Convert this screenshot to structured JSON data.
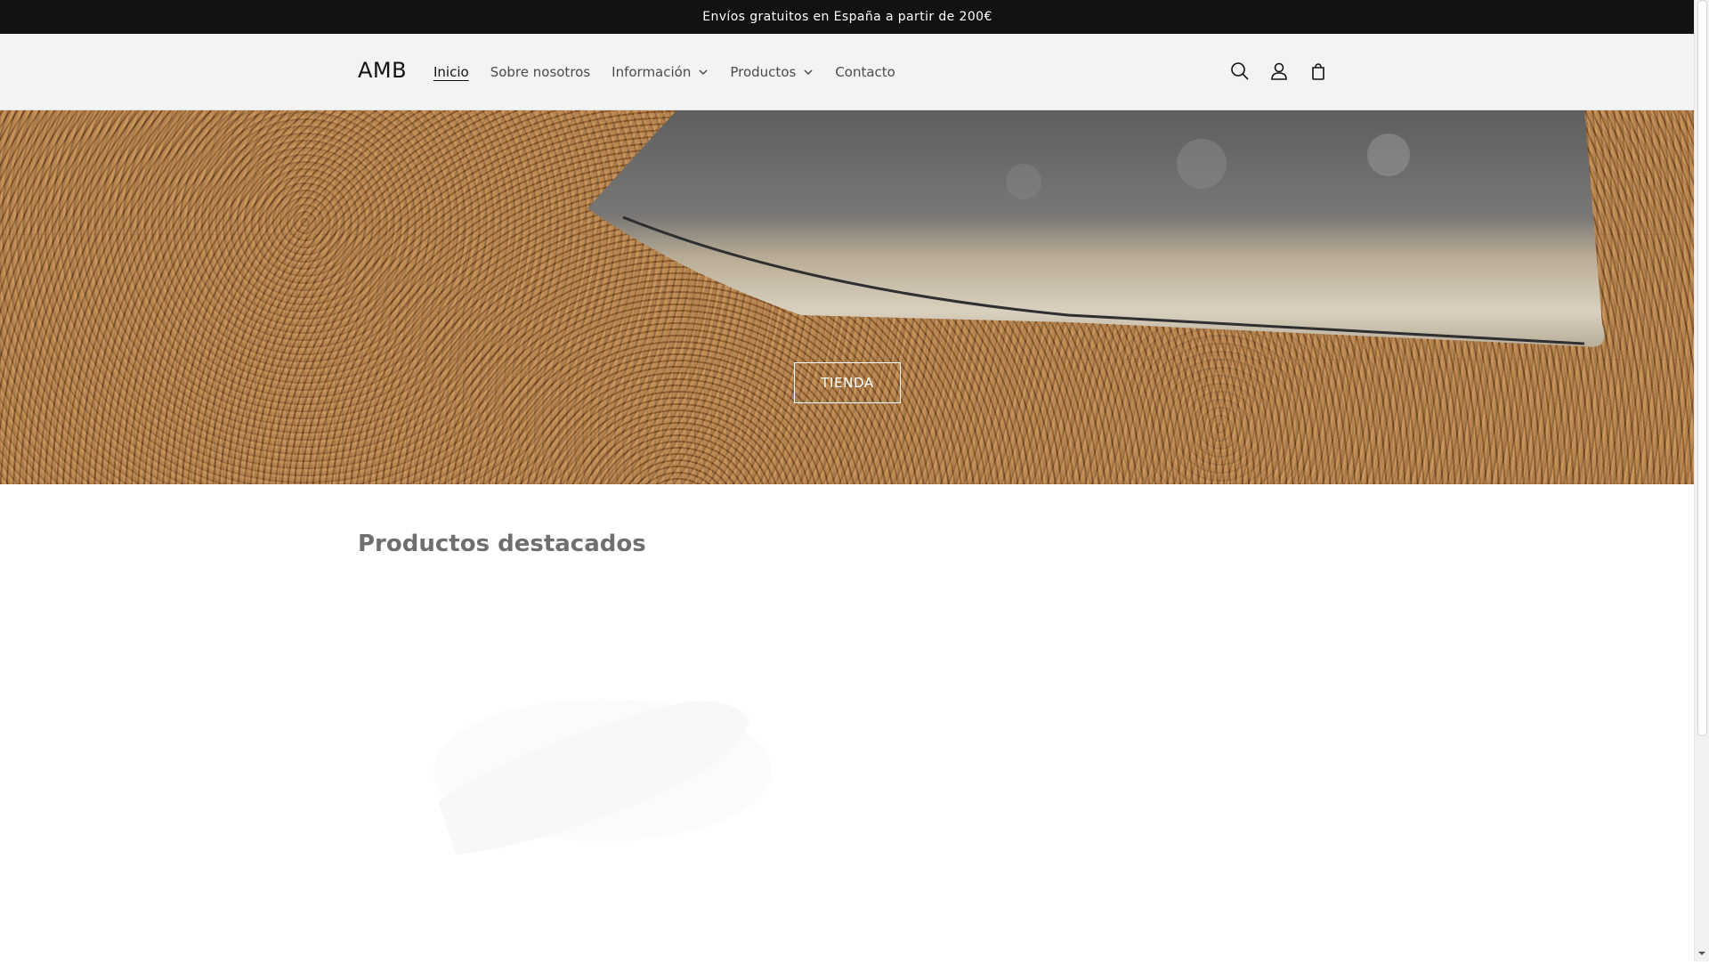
{
  "announcement": {
    "text": "Envíos gratuitos en España a partir de 200€"
  },
  "header": {
    "logo": "AMB",
    "nav": [
      {
        "label": "Inicio",
        "active": true,
        "dropdown": false
      },
      {
        "label": "Sobre nosotros",
        "active": false,
        "dropdown": false
      },
      {
        "label": "Información",
        "active": false,
        "dropdown": true
      },
      {
        "label": "Productos",
        "active": false,
        "dropdown": true
      },
      {
        "label": "Contacto",
        "active": false,
        "dropdown": false
      }
    ],
    "icons": [
      "search-icon",
      "account-icon",
      "cart-icon"
    ]
  },
  "hero": {
    "button_label": "TIENDA"
  },
  "featured": {
    "title": "Productos destacados"
  },
  "colors": {
    "announcement_bg": "#121212",
    "header_bg": "#f3f3f3",
    "wood": "#a8774a"
  }
}
